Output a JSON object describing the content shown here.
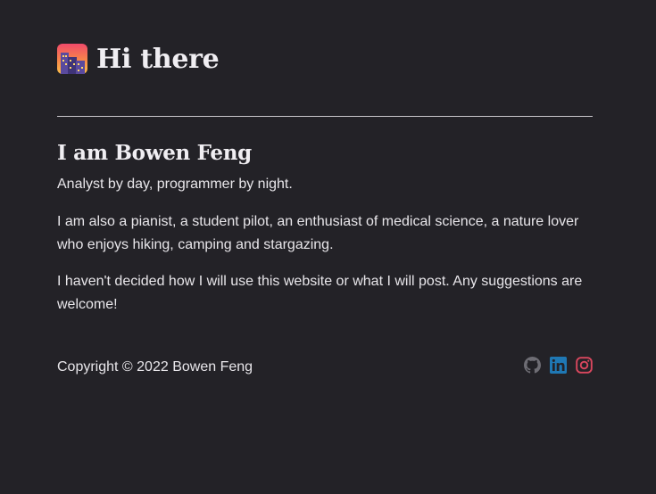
{
  "header": {
    "emoji": "night-city-emoji",
    "title": "Hi there"
  },
  "intro": {
    "name": "I am Bowen Feng",
    "tagline": "Analyst by day, programmer by night.",
    "paragraphs": [
      "I am also a pianist, a student pilot, an enthusiast of medical science, a nature lover who enjoys hiking, camping and stargazing.",
      "I haven't decided how I will use this website or what I will post. Any suggestions are welcome!"
    ]
  },
  "footer": {
    "copyright": "Copyright © 2022 Bowen Feng",
    "social": [
      {
        "name": "github-icon",
        "color": "#6e6d74"
      },
      {
        "name": "linkedin-icon",
        "color": "#1f78b4"
      },
      {
        "name": "instagram-icon",
        "color": "#d9475e"
      }
    ]
  },
  "colors": {
    "background": "#232227",
    "text": "#e8e6ea",
    "divider": "#c9c7cc"
  }
}
